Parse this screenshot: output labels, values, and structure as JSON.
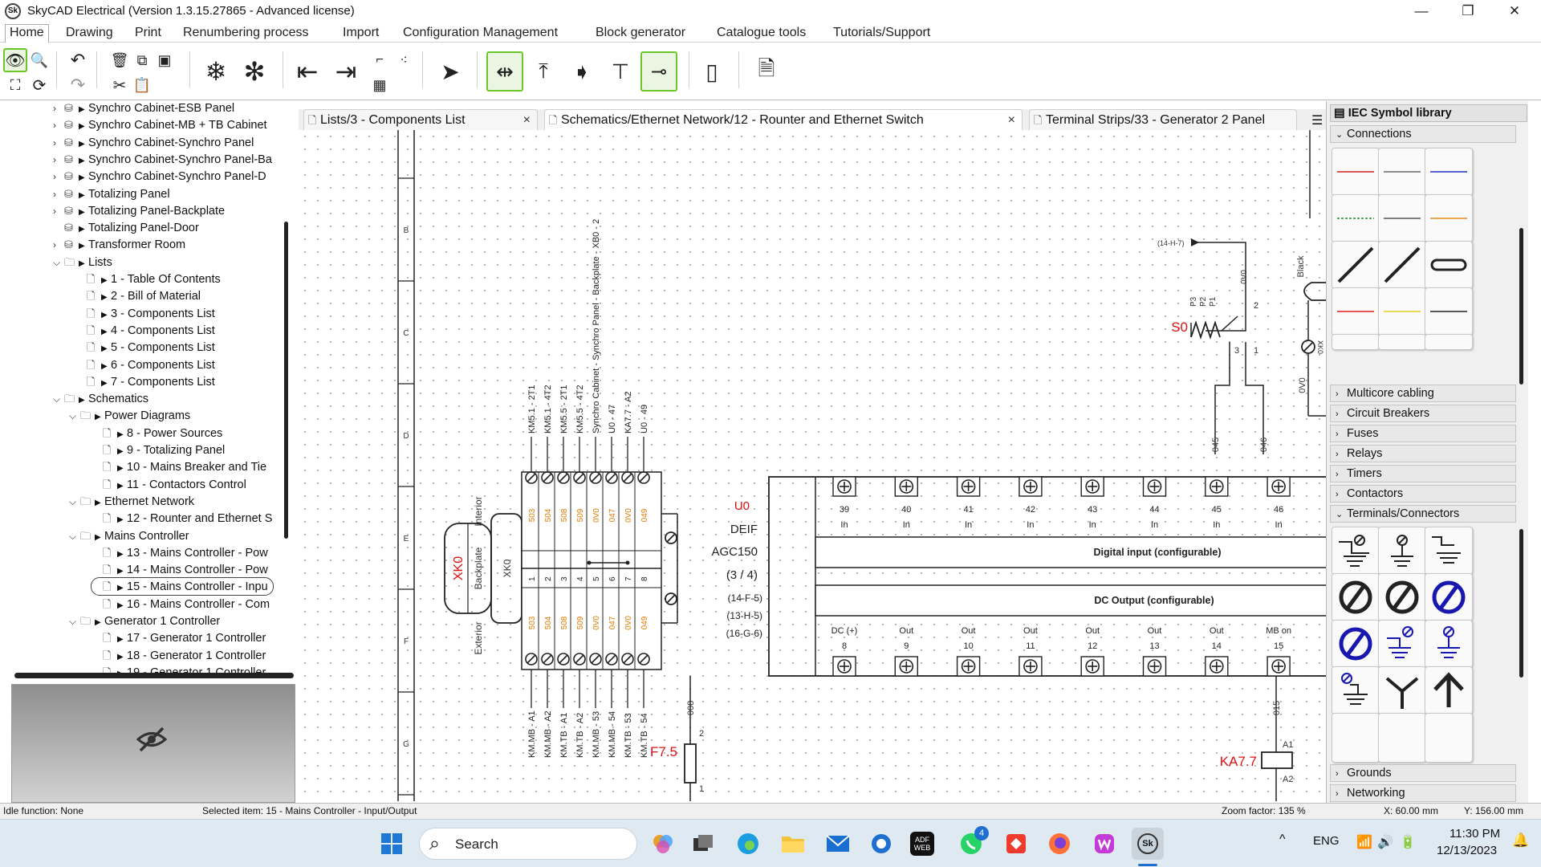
{
  "app": {
    "logo": "Sk",
    "title": "SkyCAD Electrical (Version 1.3.15.27865 - Advanced license)"
  },
  "window_controls": {
    "minimize": "—",
    "maximize": "❐",
    "close": "✕"
  },
  "menu": [
    "Home",
    "Drawing",
    "Print",
    "Renumbering process",
    "Import",
    "Configuration Management",
    "Block generator",
    "Catalogue tools",
    "Tutorials/Support"
  ],
  "tree": [
    {
      "label": "Synchro Cabinet-ESB Panel",
      "icon": "cabinet-icon"
    },
    {
      "label": "Synchro Cabinet-MB + TB Cabinet",
      "icon": "cabinet-icon"
    },
    {
      "label": "Synchro Cabinet-Synchro Panel",
      "icon": "cabinet-icon"
    },
    {
      "label": "Synchro Cabinet-Synchro Panel-Ba",
      "icon": "cabinet-icon"
    },
    {
      "label": "Synchro Cabinet-Synchro Panel-D",
      "icon": "cabinet-icon"
    },
    {
      "label": "Totalizing Panel",
      "icon": "cabinet-icon"
    },
    {
      "label": "Totalizing Panel-Backplate",
      "icon": "cabinet-icon"
    },
    {
      "label": "Totalizing Panel-Door",
      "icon": "cabinet-icon"
    },
    {
      "label": "Transformer Room",
      "icon": "cabinet-icon"
    },
    {
      "label": "Lists",
      "icon": "folder-icon"
    },
    {
      "label": "1 - Table Of Contents",
      "icon": "document-icon"
    },
    {
      "label": "2 - Bill of Material",
      "icon": "document-icon"
    },
    {
      "label": "3 - Components List",
      "icon": "document-icon"
    },
    {
      "label": "4 - Components List",
      "icon": "document-icon"
    },
    {
      "label": "5 - Components List",
      "icon": "document-icon"
    },
    {
      "label": "6 - Components List",
      "icon": "document-icon"
    },
    {
      "label": "7 - Components List",
      "icon": "document-icon"
    },
    {
      "label": "Schematics",
      "icon": "folder-icon"
    },
    {
      "label": "Power Diagrams",
      "icon": "folder-icon"
    },
    {
      "label": "8 - Power Sources",
      "icon": "document-icon"
    },
    {
      "label": "9 - Totalizing Panel",
      "icon": "document-icon"
    },
    {
      "label": "10 - Mains Breaker and Tie",
      "icon": "document-icon"
    },
    {
      "label": "11 - Contactors Control",
      "icon": "document-icon"
    },
    {
      "label": "Ethernet Network",
      "icon": "folder-icon"
    },
    {
      "label": "12 - Rounter and Ethernet S",
      "icon": "document-icon"
    },
    {
      "label": "Mains Controller",
      "icon": "folder-icon"
    },
    {
      "label": "13 - Mains Controller - Pow",
      "icon": "document-icon"
    },
    {
      "label": "14 - Mains Controller - Pow",
      "icon": "document-icon"
    },
    {
      "label": "15 - Mains Controller - Inpu",
      "icon": "document-icon"
    },
    {
      "label": "16 - Mains Controller - Com",
      "icon": "document-icon"
    },
    {
      "label": "Generator 1 Controller",
      "icon": "folder-icon"
    },
    {
      "label": "17 - Generator 1 Controller",
      "icon": "document-icon"
    },
    {
      "label": "18 - Generator 1 Controller",
      "icon": "document-icon"
    },
    {
      "label": "19 - Generator 1 Controller",
      "icon": "document-icon"
    }
  ],
  "tabs": [
    {
      "label": "Lists/3 - Components List",
      "close": "×"
    },
    {
      "label": "Schematics/Ethernet Network/12 - Rounter and Ethernet Switch",
      "close": "×"
    },
    {
      "label": "Terminal Strips/33 - Generator 2 Panel",
      "close": ""
    }
  ],
  "symbol_library": {
    "title": "IEC Symbol library",
    "sections": [
      "Connections",
      "Multicore cabling",
      "Circuit Breakers",
      "Fuses",
      "Relays",
      "Timers",
      "Contactors",
      "Terminals/Connectors",
      "Grounds",
      "Networking"
    ]
  },
  "drawing": {
    "row_labels": [
      "B",
      "C",
      "D",
      "E",
      "F",
      "G"
    ],
    "strip_top_labels": [
      "KM5.1 - 2T1",
      "KM5.1 - 4T2",
      "KM5.5 - 2T1",
      "KM5.5 - 4T2",
      "Synchro Cabinet - Synchro Panel - Backplate - XB0 - 2",
      "U0 - 47",
      "KA7.7 - A2",
      "U0 - 49"
    ],
    "strip_bottom_labels": [
      "KM.MB - A1",
      "KM.MB - A2",
      "KM.TB - A1",
      "KM.TB - A2",
      "KM.MB - 53",
      "KM.MB - 54",
      "KM.TB - 53",
      "KM.TB - 54"
    ],
    "strip_wires": [
      "503",
      "504",
      "508",
      "509",
      "0V0",
      "047",
      "0V0",
      "049"
    ],
    "strip_numbers": [
      "1",
      "2",
      "3",
      "4",
      "5",
      "6",
      "7",
      "8"
    ],
    "xk_label": "XK0",
    "xk_backplate": "Backplate",
    "xk_interior": "Interior",
    "xk_exterior": "Exterior",
    "xk_inner": "XK0",
    "controller": {
      "ref": "U0",
      "name": "DEIF",
      "model": "AGC150",
      "sheet": "(3 / 4)",
      "refs": [
        "(14-F-5)",
        "(13-H-5)",
        "(16-G-6)"
      ]
    },
    "inputs": [
      "39",
      "40",
      "41",
      "42",
      "43",
      "44",
      "45",
      "46"
    ],
    "input_type": "In",
    "digital_input_label": "Digital input (configurable)",
    "dc_output_label": "DC Output (configurable)",
    "outputs": [
      {
        "name": "DC (+)",
        "num": "8"
      },
      {
        "name": "Out",
        "num": "9"
      },
      {
        "name": "Out",
        "num": "10"
      },
      {
        "name": "Out",
        "num": "11"
      },
      {
        "name": "Out",
        "num": "12"
      },
      {
        "name": "Out",
        "num": "13"
      },
      {
        "name": "Out",
        "num": "14"
      },
      {
        "name": "MB on",
        "num": "15"
      }
    ],
    "s0": {
      "ref": "S0",
      "xref": "(14-H-7)",
      "wire_top": "0V0",
      "pins": [
        "P1",
        "P2",
        "P3"
      ],
      "n2": "2",
      "n3": "3",
      "n1": "1"
    },
    "wires_mid": [
      "045",
      "046"
    ],
    "black_label": "Black",
    "xk_side": "XK0",
    "ov0_side": "0V0",
    "f75": {
      "ref": "F7.5",
      "wire": "008",
      "top": "2",
      "bottom": "1"
    },
    "ka77": {
      "ref": "KA7.7",
      "wire": "015",
      "a1": "A1",
      "a2": "A2"
    }
  },
  "status": {
    "idle": "Idle function: None",
    "selected": "Selected item: 15 - Mains Controller - Input/Output",
    "zoom": "Zoom factor: 135 %",
    "x": "X: 60.00 mm",
    "y": "Y: 156.00 mm"
  },
  "taskbar": {
    "search_placeholder": "Search",
    "lang": "ENG",
    "time": "11:30 PM",
    "date": "12/13/2023",
    "badge": "4",
    "adf_label": "ADF WEB",
    "sk_label": "Sk",
    "chevron": "^"
  },
  "colors": {
    "accent_green": "#69c72a",
    "red_text": "#e01010",
    "orange_text": "#e07b00"
  }
}
